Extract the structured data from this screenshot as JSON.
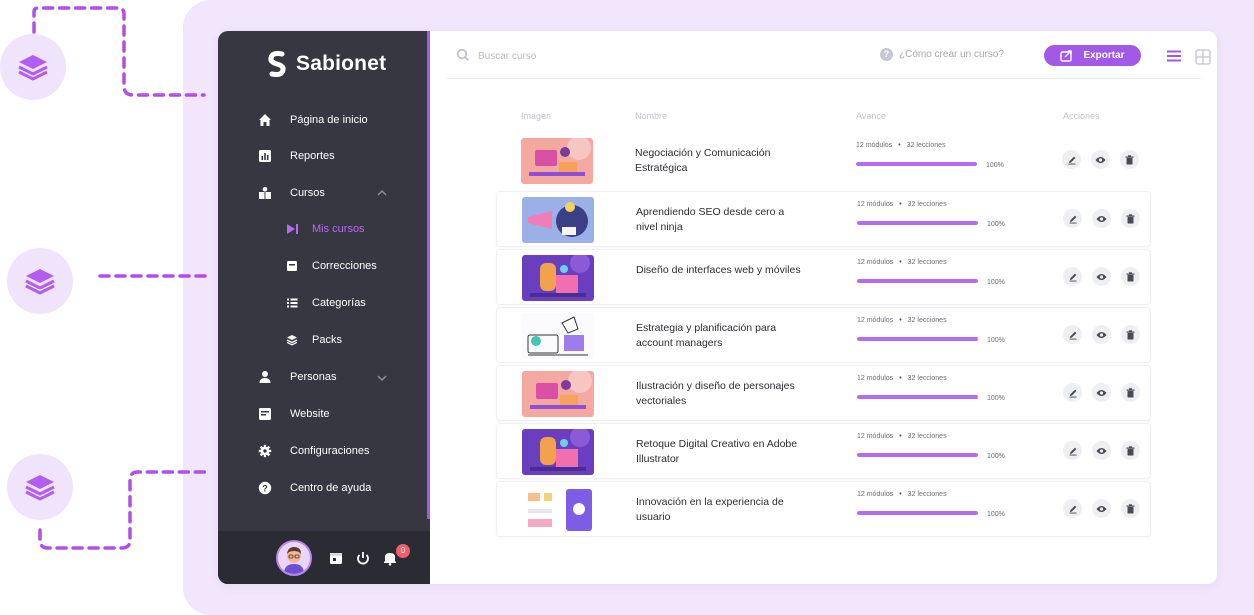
{
  "app": {
    "brand_name": "Sabionet"
  },
  "search": {
    "placeholder": "Buscar curso"
  },
  "header": {
    "help_text": "¿Cómo crear un curso?",
    "help_icon": "question-circle-icon",
    "export_label": "Exportar"
  },
  "sidebar": {
    "items": [
      {
        "label": "Página de inicio",
        "icon": "home-icon"
      },
      {
        "label": "Reportes",
        "icon": "chart-icon"
      },
      {
        "label": "Cursos",
        "icon": "courses-icon"
      },
      {
        "label": "Mis cursos",
        "icon": "play-icon"
      },
      {
        "label": "Correcciones",
        "icon": "inbox-icon"
      },
      {
        "label": "Categorías",
        "icon": "list-icon"
      },
      {
        "label": "Packs",
        "icon": "stack-icon"
      },
      {
        "label": "Personas",
        "icon": "person-icon"
      },
      {
        "label": "Website",
        "icon": "website-icon"
      },
      {
        "label": "Configuraciones",
        "icon": "gear-icon"
      },
      {
        "label": "Centro de ayuda",
        "icon": "help-icon"
      }
    ],
    "notification_count": "0"
  },
  "table": {
    "columns": [
      "Imagen",
      "Nombre",
      "Avance",
      "Acciones"
    ],
    "rows": [
      {
        "name": "Negociación y Comunicación Estratégica",
        "modules": "12 módulos",
        "lessons": "32 lecciones",
        "progress_label": "100%",
        "progress": 100
      },
      {
        "name": "Aprendiendo SEO desde cero a nivel ninja",
        "modules": "12 módulos",
        "lessons": "32 lecciones",
        "progress_label": "100%",
        "progress": 100
      },
      {
        "name": "Diseño de interfaces web y móviles",
        "modules": "12 módulos",
        "lessons": "32 lecciones",
        "progress_label": "100%",
        "progress": 100
      },
      {
        "name": "Estrategia y planificación para account managers",
        "modules": "12 módulos",
        "lessons": "32 lecciones",
        "progress_label": "100%",
        "progress": 100
      },
      {
        "name": "Ilustración y diseño de personajes vectoriales",
        "modules": "12 módulos",
        "lessons": "32 lecciones",
        "progress_label": "100%",
        "progress": 100
      },
      {
        "name": "Retoque Digital Creativo en Adobe Illustrator",
        "modules": "12 módulos",
        "lessons": "32 lecciones",
        "progress_label": "100%",
        "progress": 100
      },
      {
        "name": "Innovación en la experiencia de usuario",
        "modules": "12 módulos",
        "lessons": "32 lecciones",
        "progress_label": "100%",
        "progress": 100
      }
    ]
  },
  "colors": {
    "accent": "#a259e6",
    "sidebar_bg": "#363740",
    "backdrop": "#f1e6fc"
  }
}
